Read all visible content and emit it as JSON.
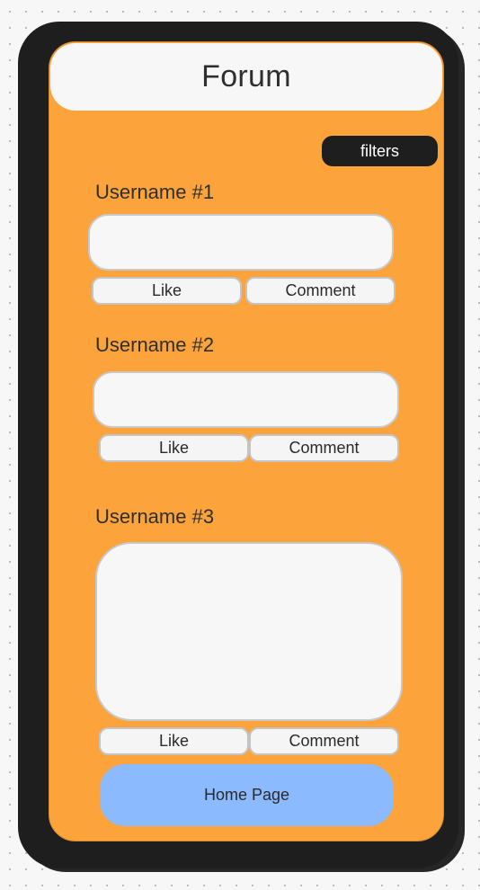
{
  "header": {
    "title": "Forum"
  },
  "toolbar": {
    "filters_label": "filters"
  },
  "posts": [
    {
      "username": "Username #1",
      "like_label": "Like",
      "comment_label": "Comment"
    },
    {
      "username": "Username #2",
      "like_label": "Like",
      "comment_label": "Comment"
    },
    {
      "username": "Username #3",
      "like_label": "Like",
      "comment_label": "Comment"
    }
  ],
  "footer": {
    "home_label": "Home Page"
  },
  "colors": {
    "screen_background": "#fca43b",
    "phone_frame": "#1e1e1e",
    "home_button": "#8bbaff",
    "card_background": "#f7f7f7"
  }
}
